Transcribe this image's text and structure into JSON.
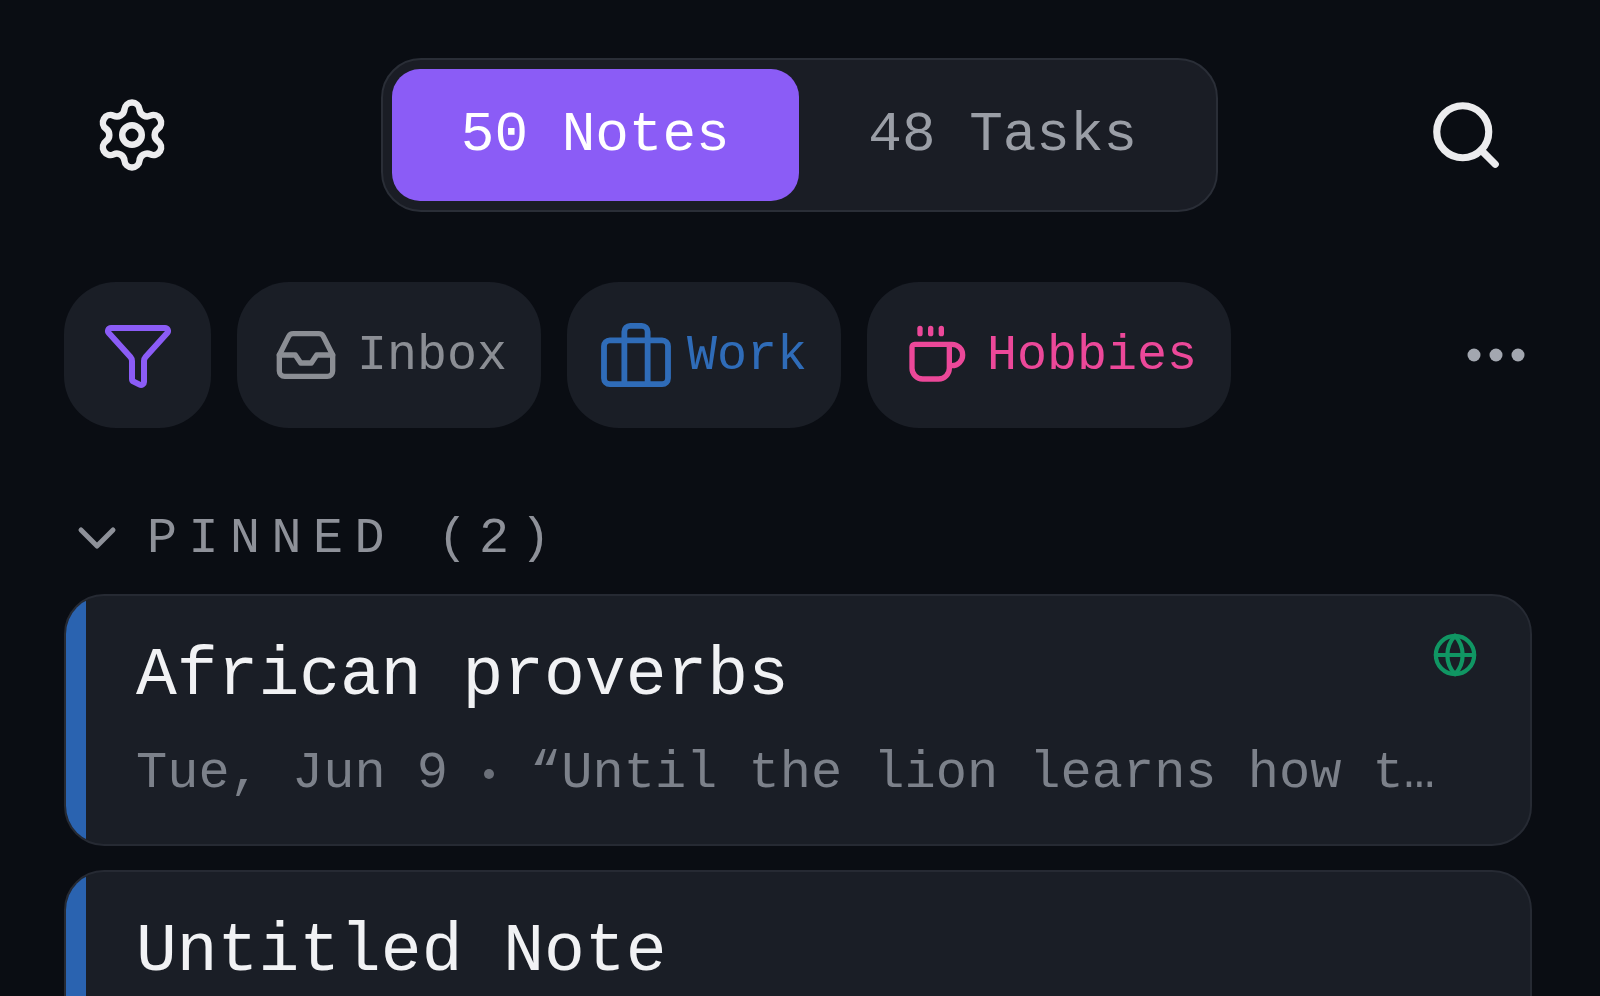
{
  "tabs": [
    {
      "label": "50 Notes",
      "selected": true
    },
    {
      "label": "48 Tasks",
      "selected": false
    }
  ],
  "chips": [
    {
      "label": "Inbox",
      "color": "#8b8e94"
    },
    {
      "label": "Work",
      "color": "#2f6cb8"
    },
    {
      "label": "Hobbies",
      "color": "#ec4899"
    }
  ],
  "pinned": {
    "title": "PINNED (2)",
    "expanded": true,
    "items": [
      {
        "title": "African proverbs",
        "date": "Tue, Jun 9",
        "preview": "“Until the lion learns how t…",
        "published": true,
        "color": "#2a63b0"
      },
      {
        "title": "Untitled Note",
        "published": false,
        "color": "#2a63b0"
      }
    ]
  }
}
